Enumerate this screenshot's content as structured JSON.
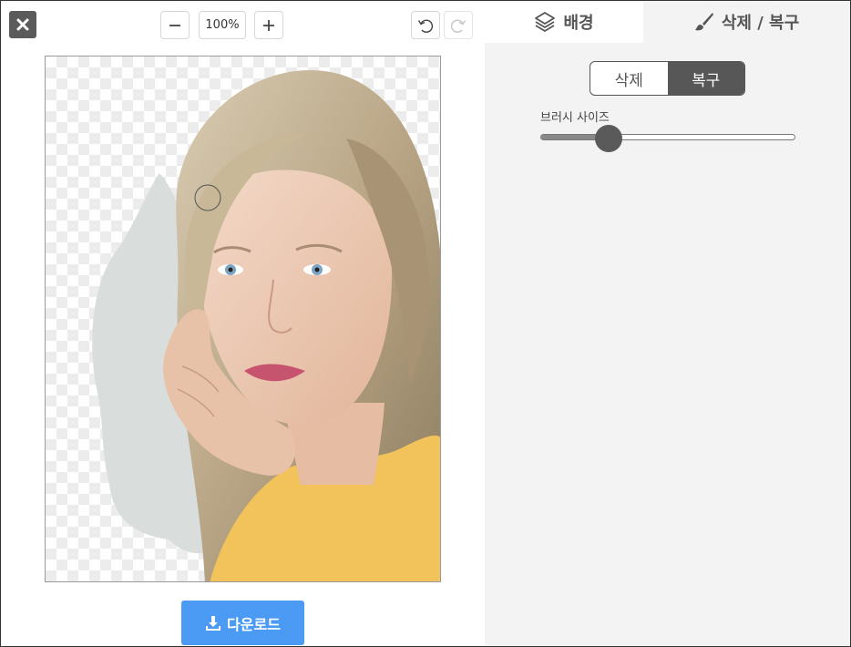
{
  "toolbar": {
    "zoom_level": "100%",
    "close_icon": "close-icon",
    "zoom_out_icon": "minus-icon",
    "zoom_in_icon": "plus-icon",
    "undo_icon": "undo-icon",
    "redo_icon": "redo-icon"
  },
  "tabs": [
    {
      "label": "배경",
      "icon": "layers-icon",
      "active": false
    },
    {
      "label": "삭제 / 복구",
      "icon": "brush-icon",
      "active": true
    }
  ],
  "mode_toggle": {
    "options": [
      "삭제",
      "복구"
    ],
    "selected": "복구"
  },
  "brush": {
    "label": "브러시 사이즈",
    "value_fraction": 0.25
  },
  "download": {
    "label": "다운로드",
    "icon": "download-icon"
  },
  "colors": {
    "accent": "#4b9bf5",
    "dark": "#575757",
    "panel": "#f3f3f4"
  }
}
